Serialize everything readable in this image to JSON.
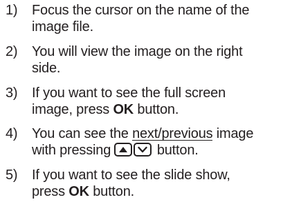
{
  "steps": [
    {
      "number": "1)",
      "line1": "Focus the cursor on the name of the",
      "line2": "image file."
    },
    {
      "number": "2)",
      "line1": "You will view the image on the right",
      "line2": "side."
    },
    {
      "number": "3)",
      "line1": "If you want to see the full screen",
      "line2_pre": "image, press ",
      "line2_bold": "OK",
      "line2_post": " button."
    },
    {
      "number": "4)",
      "line1_pre": "You can see the ",
      "line1_underlined": "next/previous",
      "line1_post": " image",
      "line2_pre": "with pressing ",
      "line2_post": " button.",
      "icons": [
        "up-arrow-button-icon",
        "down-arrow-button-icon"
      ]
    },
    {
      "number": "5)",
      "line1": "If you want to see the slide show,",
      "line2_pre": "press ",
      "line2_bold": "OK",
      "line2_post": " button."
    }
  ]
}
